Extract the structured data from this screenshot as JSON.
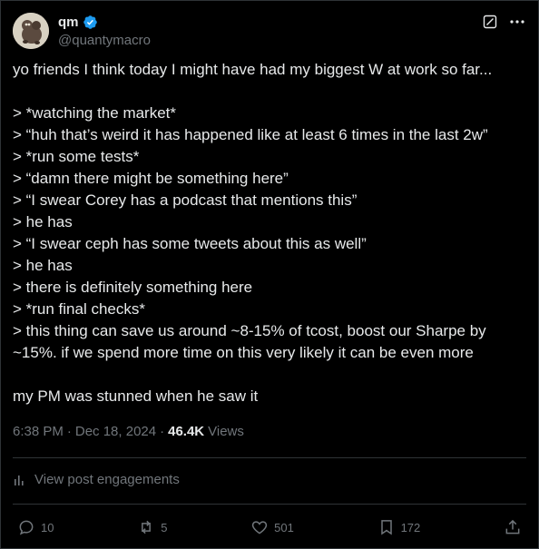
{
  "author": {
    "display_name": "qm",
    "handle": "@quantymacro",
    "verified": true,
    "avatar_icon": "avatar-image"
  },
  "header_icons": [
    "grok-icon",
    "more-options-icon"
  ],
  "tweet": {
    "lines": [
      "yo friends I think today I might have had my biggest W at work so far...",
      "",
      "> *watching the market*",
      "> “huh that’s weird it has happened like at least 6 times in the last 2w”",
      "> *run some tests*",
      "> “damn there might be something here”",
      "> “I swear Corey has a podcast that mentions this”",
      "> he has",
      "> “I swear ceph has some tweets about this as well”",
      "> he has",
      "> there is definitely something here",
      "> *run final checks*",
      "> this thing can save us around ~8-15% of tcost, boost our Sharpe by",
      "~15%. if we spend more time on this very likely it can be even more",
      "",
      "my PM was stunned when he saw it"
    ]
  },
  "meta": {
    "time": "6:38 PM",
    "separator": "·",
    "date": "Dec 18, 2024",
    "views_count": "46.4K",
    "views_label": "Views"
  },
  "engagements": {
    "label": "View post engagements",
    "icon": "analytics-icon"
  },
  "actions": {
    "reply_count": "10",
    "repost_count": "5",
    "like_count": "501",
    "bookmark_count": "172"
  },
  "colors": {
    "background": "#000000",
    "text": "#e7e9ea",
    "secondary": "#71767b",
    "border": "#2f3336",
    "verified": "#1d9bf0"
  }
}
